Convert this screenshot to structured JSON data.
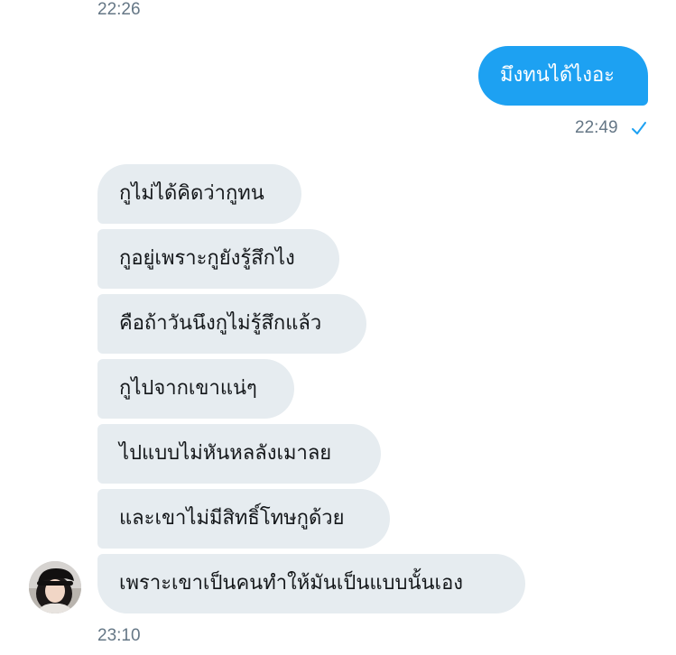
{
  "timestamps": {
    "top": "22:26",
    "sent_time": "22:49",
    "bottom": "23:10"
  },
  "sent_message": "มึงทนได้ไงอะ",
  "received_messages": [
    "กูไม่ได้คิดว่ากูทน",
    "กูอยู่เพราะกูยังรู้สึกไง",
    "คือถ้าวันนึงกูไม่รู้สึกแล้ว",
    "กูไปจากเขาแน่ๆ",
    "ไปแบบไม่หันหลลังเมาลย",
    "และเขาไม่มีสิทธิ์โทษกูด้วย",
    "เพราะเขาเป็นคนทำให้มันเป็นแบบนั้นเอง"
  ],
  "colors": {
    "sent_bubble": "#1da1f2",
    "received_bubble": "#e6ecf0",
    "timestamp": "#657786"
  },
  "icons": {
    "read_receipt": "checkmark-icon",
    "avatar": "user-avatar"
  }
}
